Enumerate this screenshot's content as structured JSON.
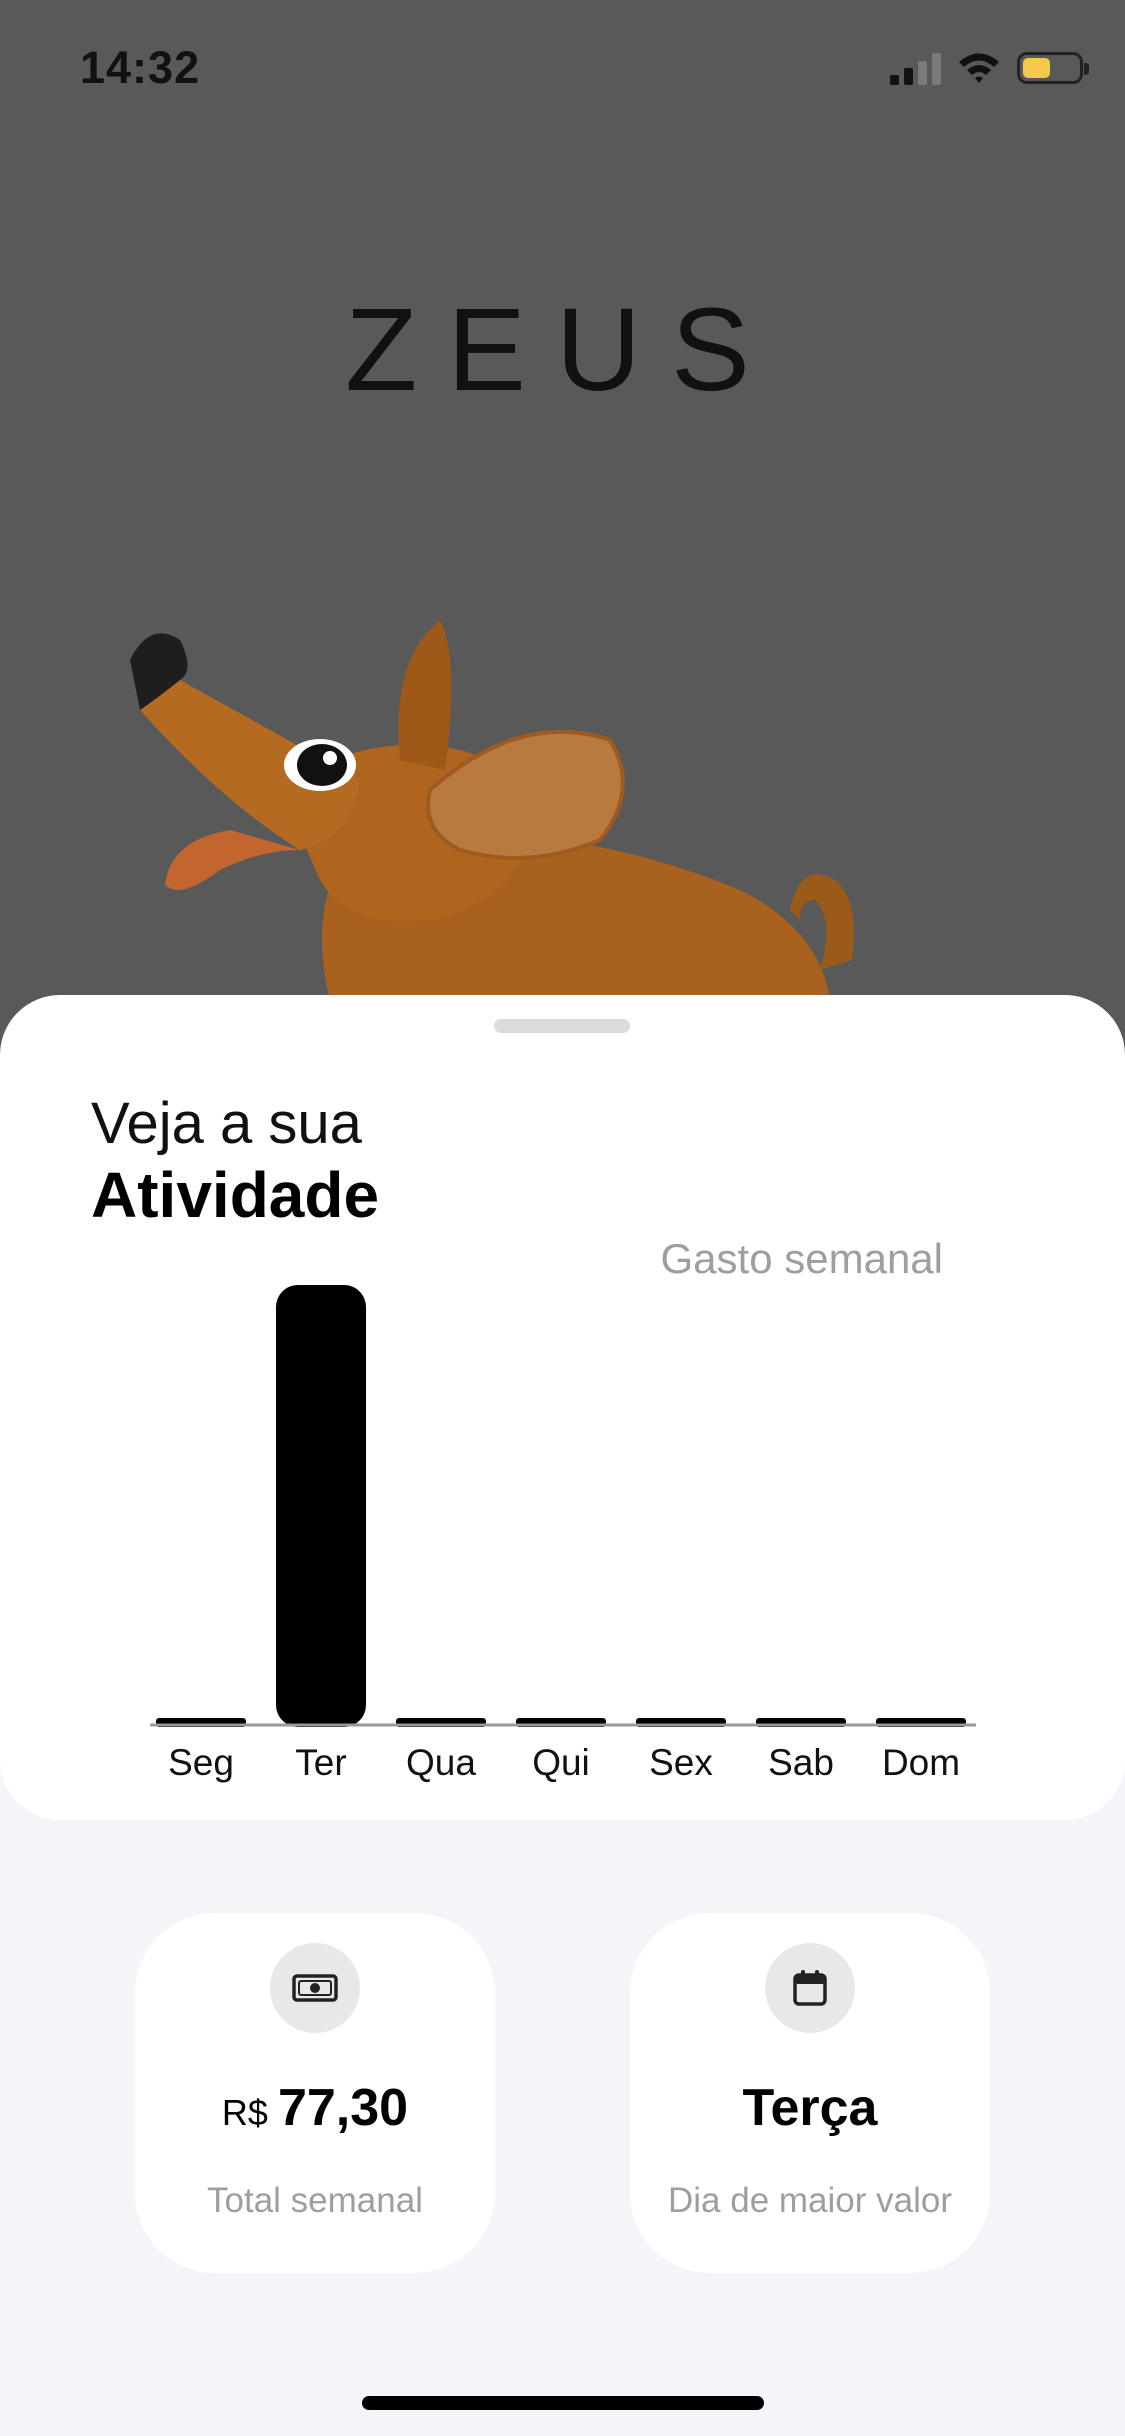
{
  "status_bar": {
    "time": "14:32",
    "signal_icon": "cellular-signal-icon",
    "wifi_icon": "wifi-icon",
    "battery_icon": "battery-icon",
    "battery_level": 0.45,
    "battery_color": "#f2c94c"
  },
  "hero": {
    "title": "ZEUS",
    "overlay_color": "#595959",
    "mascot": "dachshund-mascot-illustration"
  },
  "activity": {
    "subtitle": "Veja a sua",
    "title": "Atividade",
    "chart_caption": "Gasto semanal"
  },
  "chart_data": {
    "type": "bar",
    "categories": [
      "Seg",
      "Ter",
      "Qua",
      "Qui",
      "Sex",
      "Sab",
      "Dom"
    ],
    "values": [
      0,
      77.3,
      0,
      0,
      0,
      0,
      0
    ],
    "title": "Gasto semanal",
    "xlabel": "",
    "ylabel": "",
    "ylim": [
      0,
      77.3
    ],
    "grid": false,
    "bar_color": "#000000"
  },
  "stats": {
    "total": {
      "icon": "banknote-icon",
      "currency": "R$",
      "value": "77,30",
      "label": "Total semanal"
    },
    "top_day": {
      "icon": "calendar-icon",
      "value": "Terça",
      "label": "Dia de maior valor"
    }
  }
}
